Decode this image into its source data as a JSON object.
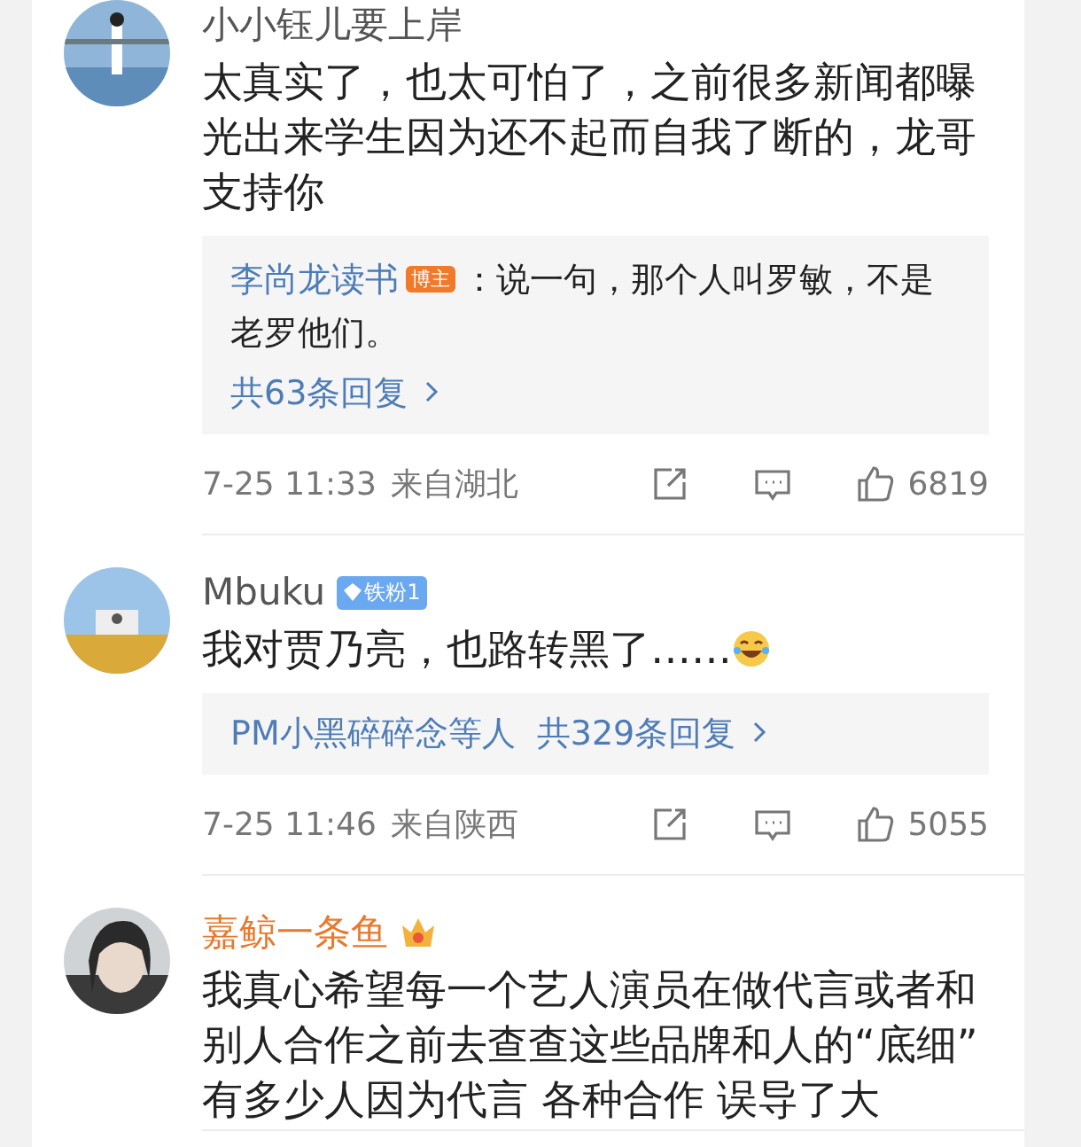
{
  "comments": [
    {
      "author": "小小钰儿要上岸",
      "vip": false,
      "text": "太真实了，也太可怕了，之前很多新闻都曝光出来学生因为还不起而自我了断的，龙哥支持你",
      "trailing_emoji": false,
      "replies": {
        "preview_author": "李尚龙读书",
        "preview_badge": "博主",
        "preview_text": "：说一句，那个人叫罗敏，不是老罗他们。",
        "total": "共63条回复"
      },
      "time": "7-25 11:33",
      "location": "来自湖北",
      "likes": "6819"
    },
    {
      "author": "Mbuku",
      "vip": false,
      "badge": "铁粉1",
      "text": "我对贾乃亮，也路转黑了……",
      "trailing_emoji": true,
      "replies": {
        "names": "PM小黑碎碎念等人",
        "total": "共329条回复"
      },
      "time": "7-25 11:46",
      "location": "来自陕西",
      "likes": "5055"
    },
    {
      "author": "嘉鲸一条鱼",
      "vip": true,
      "text": "我真心希望每一个艺人演员在做代言或者和别人合作之前去查查这些品牌和人的“底细” 有多少人因为代言 各种合作 误导了大",
      "trailing_emoji": false
    }
  ]
}
